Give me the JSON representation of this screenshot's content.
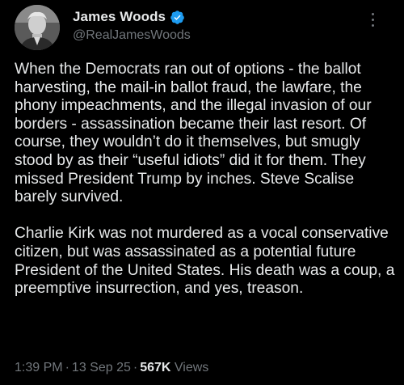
{
  "author": {
    "display_name": "James Woods",
    "handle": "@RealJamesWoods",
    "verified": true,
    "verified_color": "#1d9bf0",
    "avatar_icon": "profile-photo"
  },
  "tweet": {
    "paragraphs": [
      "When the Democrats ran out of options - the ballot harvesting, the mail-in ballot fraud, the lawfare, the phony impeachments, and the illegal invasion of our borders - assassination became their last resort. Of course, they wouldn’t do it themselves, but smugly stood by as their “useful idiots” did it for them. They missed President Trump by inches. Steve Scalise barely survived.",
      "Charlie Kirk was not murdered as a vocal conservative citizen, but was assassinated as a potential future President of the United States. His death was a coup, a preemptive insurrection, and yes, treason."
    ]
  },
  "meta": {
    "time": "1:39 PM",
    "separator": "·",
    "date": "13 Sep 25",
    "views_count": "567K",
    "views_label": "Views"
  },
  "colors": {
    "background": "#000000",
    "primary_text": "#e7e9ea",
    "secondary_text": "#71767b"
  },
  "icons": {
    "more": "more-vertical-icon",
    "verified": "verified-badge-icon"
  }
}
